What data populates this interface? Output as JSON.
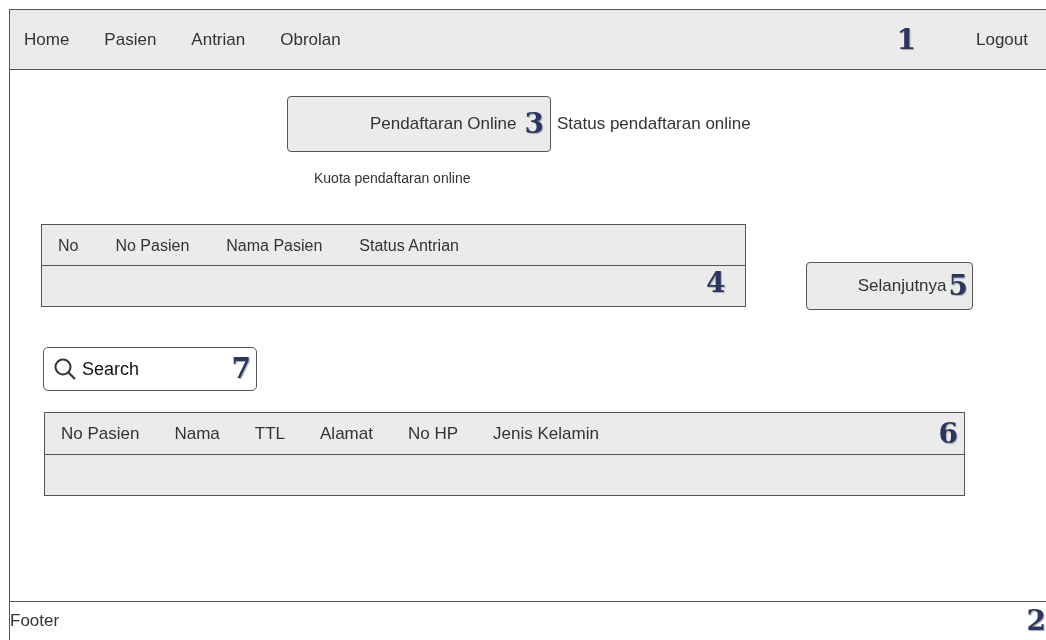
{
  "nav": {
    "items": [
      "Home",
      "Pasien",
      "Antrian",
      "Obrolan"
    ],
    "marker": "1",
    "logout": "Logout"
  },
  "registration": {
    "button": "Pendaftaran Online",
    "marker": "3",
    "status": "Status pendaftaran online",
    "quota": "Kuota pendaftaran online"
  },
  "queue_table": {
    "columns": [
      "No",
      "No Pasien",
      "Nama Pasien",
      "Status Antrian"
    ],
    "marker": "4"
  },
  "next_button": {
    "label": "Selanjutnya",
    "marker": "5"
  },
  "search": {
    "placeholder": "Search",
    "marker": "7"
  },
  "patient_table": {
    "columns": [
      "No Pasien",
      "Nama",
      "TTL",
      "Alamat",
      "No HP",
      "Jenis Kelamin"
    ],
    "marker": "6"
  },
  "footer": {
    "text": "Footer",
    "marker": "2"
  }
}
